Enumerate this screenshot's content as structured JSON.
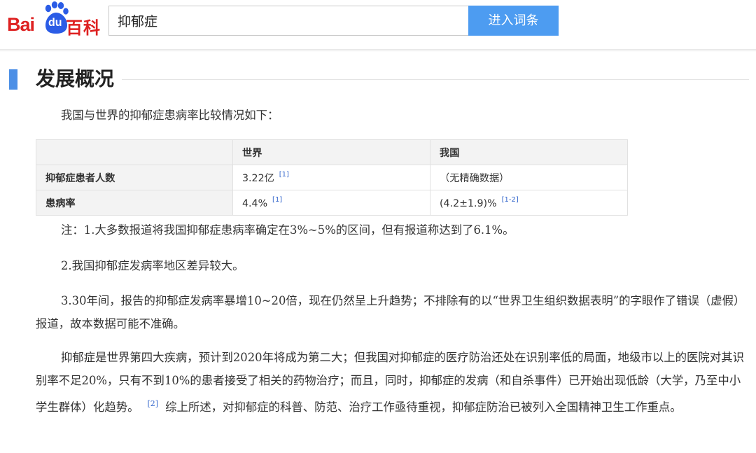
{
  "header": {
    "logo": {
      "text_bai": "Bai",
      "text_du": "du",
      "text_baike": "百科",
      "brand_red": "#de2121",
      "brand_blue": "#2b5ce6",
      "icon": "baidu-paw-icon"
    },
    "search": {
      "value": "抑郁症",
      "button_label": "进入词条",
      "button_color": "#4d9cf1"
    }
  },
  "section": {
    "title": "发展概况",
    "accent_color": "#4c8fe6",
    "intro": "我国与世界的抑郁症患病率比较情况如下："
  },
  "table": {
    "headers": [
      "",
      "世界",
      "我国"
    ],
    "rows": [
      {
        "label": "抑郁症患者人数",
        "world": "3.22亿",
        "world_ref": "[1]",
        "china": "（无精确数据）",
        "china_ref": ""
      },
      {
        "label": "患病率",
        "world": "4.4%",
        "world_ref": "[1]",
        "china": "(4.2±1.9)%",
        "china_ref": "[1-2]"
      }
    ]
  },
  "notes": {
    "note1": "注：1.大多数报道将我国抑郁症患病率确定在3%~5%的区间，但有报道称达到了6.1%。",
    "note2": "2.我国抑郁症发病率地区差异较大。",
    "note3": "3.30年间，报告的抑郁症发病率暴增10~20倍，现在仍然呈上升趋势；不排除有的以“世界卫生组织数据表明”的字眼作了错误（虚假）报道，故本数据可能不准确。"
  },
  "body": {
    "part1": "抑郁症是世界第四大疾病，预计到2020年将成为第二大；但我国对抑郁症的医疗防治还处在识别率低的局面，地级市以上的医院对其识别率不足20%，只有不到10%的患者接受了相关的药物治疗；而且，同时，抑郁症的发病（和自杀事件）已开始出现低龄（大学，乃至中小学生群体）化趋势。",
    "ref": "[2]",
    "part2": "综上所述，对抑郁症的科普、防范、治疗工作亟待重视，抑郁症防治已被列入全国精神卫生工作重点。"
  }
}
